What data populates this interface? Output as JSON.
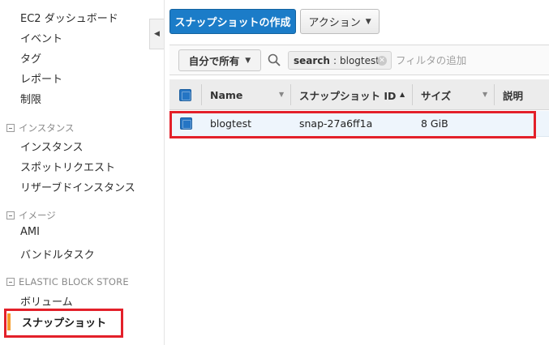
{
  "sidebar": {
    "links_top": [
      {
        "label": "EC2 ダッシュボード"
      },
      {
        "label": "イベント"
      },
      {
        "label": "タグ"
      },
      {
        "label": "レポート"
      },
      {
        "label": "制限"
      }
    ],
    "sections": [
      {
        "header": "インスタンス",
        "items": [
          {
            "label": "インスタンス"
          },
          {
            "label": "スポットリクエスト"
          },
          {
            "label": "リザーブドインスタンス"
          }
        ]
      },
      {
        "header": "イメージ",
        "items": [
          {
            "label": "AMI"
          },
          {
            "label": "バンドルタスク"
          }
        ]
      },
      {
        "header": "ELASTIC BLOCK STORE",
        "items": [
          {
            "label": "ボリューム"
          },
          {
            "label": "スナップショット"
          }
        ]
      }
    ],
    "active_color": "#f59b28"
  },
  "toolbar": {
    "create_label": "スナップショットの作成",
    "actions_label": "アクション",
    "primary_color": "#1b7cc8"
  },
  "filter": {
    "owner_label": "自分で所有",
    "token_key": "search",
    "token_sep": ":",
    "token_value": "blogtest",
    "placeholder": "フィルタの追加"
  },
  "table": {
    "columns": [
      "Name",
      "スナップショット ID",
      "サイズ",
      "説明"
    ],
    "rows": [
      {
        "name": "blogtest",
        "snapshot_id": "snap-27a6ff1a",
        "size": "8 GiB",
        "description": ""
      }
    ]
  },
  "annotation_color": "#e3202a"
}
